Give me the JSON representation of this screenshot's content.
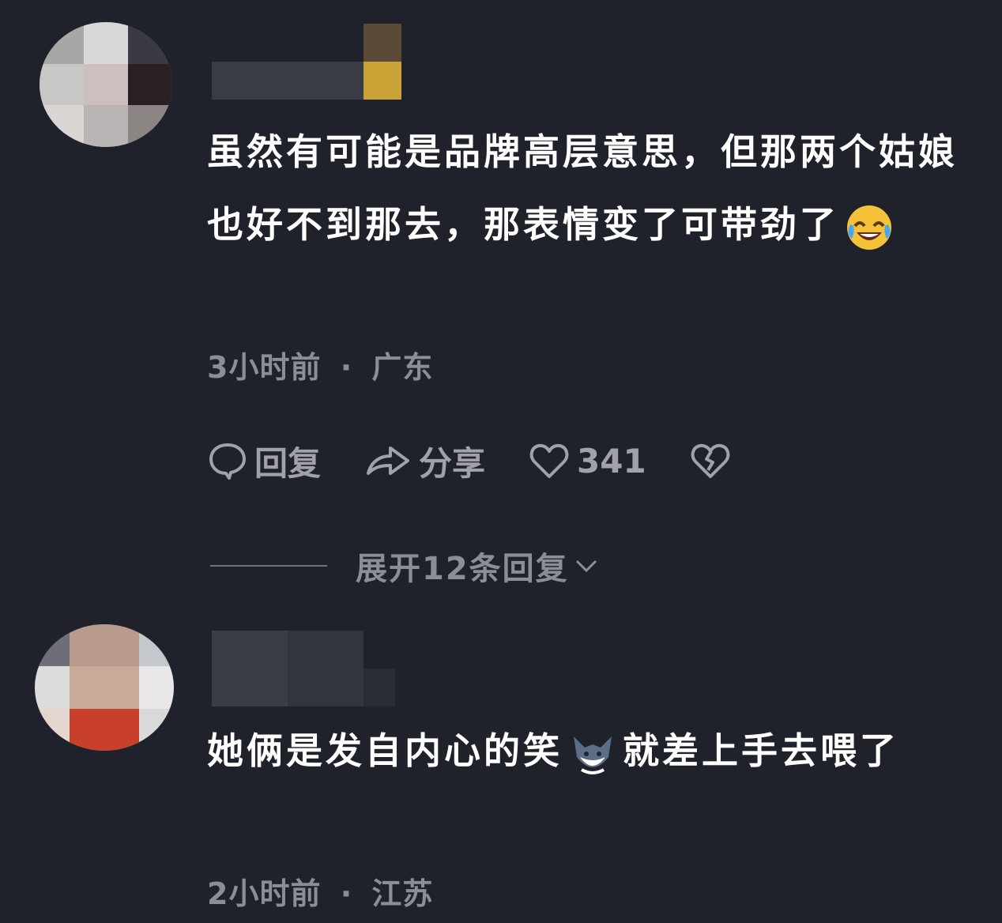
{
  "comments": [
    {
      "text_part1": "虽然有可能是品牌高层意思，但那两个姑娘也好不到那去，那表情变了可带劲了",
      "emoji": "laughing-crying-emoji",
      "time": "3小时前",
      "separator": "·",
      "location": "广东",
      "actions": {
        "reply_label": "回复",
        "share_label": "分享",
        "like_count": "341"
      },
      "expand_replies_label": "展开12条回复"
    },
    {
      "text_part1": "她俩是发自内心的笑",
      "emoji": "fox-emoji",
      "text_part2": "就差上手去喂了",
      "time": "2小时前",
      "separator": "·",
      "location": "江苏"
    }
  ],
  "colors": {
    "background": "#1f222b",
    "text": "#ffffff",
    "meta": "#8c8e95",
    "action": "#a0a2a8"
  }
}
